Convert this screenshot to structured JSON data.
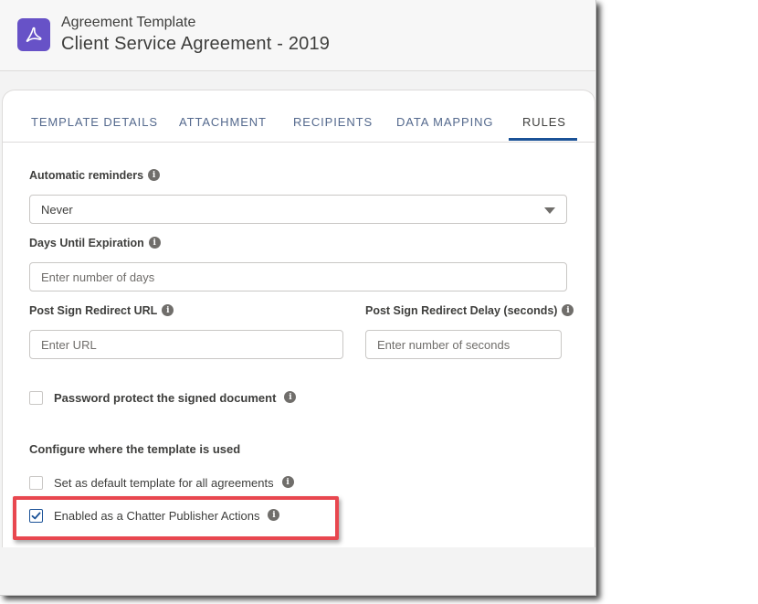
{
  "header": {
    "subtitle": "Agreement Template",
    "title": "Client Service Agreement - 2019",
    "icon": "adobe-acrobat-icon",
    "icon_bg": "#6752c7"
  },
  "tabs": [
    {
      "label": "TEMPLATE DETAILS",
      "active": false
    },
    {
      "label": "ATTACHMENT",
      "active": false
    },
    {
      "label": "RECIPIENTS",
      "active": false
    },
    {
      "label": "DATA MAPPING",
      "active": false
    },
    {
      "label": "RULES",
      "active": true
    }
  ],
  "form": {
    "automatic_reminders": {
      "label": "Automatic reminders",
      "value": "Never"
    },
    "days_until_expiration": {
      "label": "Days Until Expiration",
      "placeholder": "Enter number of days"
    },
    "post_sign_redirect_url": {
      "label": "Post Sign Redirect URL",
      "placeholder": "Enter URL"
    },
    "post_sign_redirect_delay": {
      "label": "Post Sign Redirect Delay (seconds)",
      "placeholder": "Enter number of seconds"
    },
    "password_protect": {
      "label": "Password protect the signed document",
      "checked": false
    },
    "configure_section": "Configure where the template is used",
    "default_template": {
      "label": "Set as default template for all agreements",
      "checked": false
    },
    "chatter_publisher": {
      "label": "Enabled as a Chatter Publisher Actions",
      "checked": true
    }
  },
  "colors": {
    "accent": "#1b5297",
    "highlight": "#e8474f"
  }
}
